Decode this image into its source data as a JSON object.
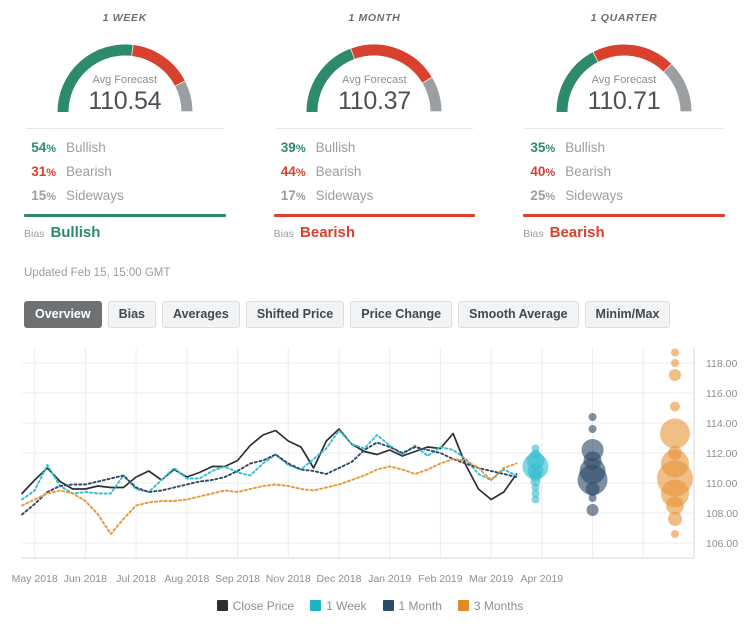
{
  "panels": [
    {
      "title": "1 WEEK",
      "gauge_label": "Avg Forecast",
      "value": "110.54",
      "bullish_pct": "54",
      "bearish_pct": "31",
      "sideways_pct": "15",
      "bullish_label": "Bullish",
      "bearish_label": "Bearish",
      "sideways_label": "Sideways",
      "bias_word": "Bias",
      "bias_value": "Bullish",
      "bias_color": "#2d8a6a"
    },
    {
      "title": "1 MONTH",
      "gauge_label": "Avg Forecast",
      "value": "110.37",
      "bullish_pct": "39",
      "bearish_pct": "44",
      "sideways_pct": "17",
      "bullish_label": "Bullish",
      "bearish_label": "Bearish",
      "sideways_label": "Sideways",
      "bias_word": "Bias",
      "bias_value": "Bearish",
      "bias_color": "#d7412e"
    },
    {
      "title": "1 QUARTER",
      "gauge_label": "Avg Forecast",
      "value": "110.71",
      "bullish_pct": "35",
      "bearish_pct": "40",
      "sideways_pct": "25",
      "bullish_label": "Bullish",
      "bearish_label": "Bearish",
      "sideways_label": "Sideways",
      "bias_word": "Bias",
      "bias_value": "Bearish",
      "bias_color": "#d7412e"
    }
  ],
  "colors": {
    "bullish": "#2d8a6a",
    "bearish": "#d7412e",
    "sideways": "#9b9fa2",
    "close_price": "#2b2f33",
    "one_week": "#35bfd0",
    "one_month": "#2d4b68",
    "three_months": "#e8963a"
  },
  "updated": "Updated Feb 15, 15:00 GMT",
  "tabs": [
    {
      "label": "Overview",
      "active": true
    },
    {
      "label": "Bias",
      "active": false
    },
    {
      "label": "Averages",
      "active": false
    },
    {
      "label": "Shifted Price",
      "active": false
    },
    {
      "label": "Price Change",
      "active": false
    },
    {
      "label": "Smooth Average",
      "active": false
    },
    {
      "label": "Minim/Max",
      "active": false
    }
  ],
  "legend": [
    {
      "label": "Close Price",
      "color": "#2b2f33"
    },
    {
      "label": "1 Week",
      "color": "#19b5c4"
    },
    {
      "label": "1 Month",
      "color": "#2d4b68"
    },
    {
      "label": "3 Months",
      "color": "#e08a28"
    }
  ],
  "chart_data": {
    "type": "line",
    "title": "",
    "xlabel": "",
    "ylabel": "",
    "ylim": [
      105.0,
      119.0
    ],
    "yticks": [
      "106.00",
      "108.00",
      "110.00",
      "112.00",
      "114.00",
      "116.00",
      "118.00"
    ],
    "ytick_values": [
      106,
      108,
      110,
      112,
      114,
      116,
      118
    ],
    "grid": true,
    "legend_position": "bottom",
    "xticks": [
      "May 2018",
      "Jun 2018",
      "Jul 2018",
      "Aug 2018",
      "Sep 2018",
      "Nov 2018",
      "Dec 2018",
      "Jan 2019",
      "Feb 2019",
      "Mar 2019",
      "Apr 2019"
    ],
    "x": [
      0,
      1,
      2,
      3,
      4,
      5,
      6,
      7,
      8,
      9,
      10,
      11,
      12,
      13,
      14,
      15,
      16,
      17,
      18,
      19,
      20,
      21,
      22,
      23,
      24,
      25,
      26,
      27,
      28,
      29,
      30,
      31,
      32,
      33,
      34,
      35,
      36,
      37,
      38,
      39
    ],
    "series": [
      {
        "name": "Close Price",
        "color": "#2b2f33",
        "style": "solid",
        "values": [
          109.3,
          110.2,
          111.0,
          110.1,
          109.6,
          109.6,
          109.8,
          109.7,
          109.7,
          110.4,
          110.8,
          110.2,
          110.9,
          110.4,
          110.7,
          111.1,
          111.1,
          111.5,
          112.5,
          113.2,
          113.5,
          112.8,
          112.4,
          111.0,
          112.8,
          113.6,
          112.6,
          112.1,
          111.9,
          112.2,
          111.8,
          112.1,
          112.4,
          112.3,
          113.3,
          111.2,
          109.6,
          108.9,
          109.4,
          110.6
        ]
      },
      {
        "name": "1 Week",
        "color": "#35bfd0",
        "style": "dotted",
        "values": [
          108.9,
          109.5,
          111.2,
          109.8,
          109.3,
          109.4,
          109.3,
          109.3,
          110.5,
          109.6,
          109.4,
          110.2,
          111.0,
          110.3,
          110.3,
          110.8,
          111.1,
          110.7,
          110.5,
          111.3,
          111.9,
          111.2,
          110.9,
          111.6,
          112.3,
          113.5,
          112.6,
          112.3,
          113.2,
          112.5,
          111.9,
          112.5,
          111.8,
          112.4,
          112.2,
          111.6,
          110.6,
          110.2,
          110.9,
          110.5
        ]
      },
      {
        "name": "1 Month",
        "color": "#2d4b68",
        "style": "dotted",
        "values": [
          107.9,
          108.6,
          109.4,
          109.8,
          109.9,
          109.9,
          110.1,
          110.3,
          110.5,
          109.7,
          109.4,
          109.5,
          109.7,
          109.9,
          110.1,
          110.2,
          110.4,
          110.8,
          111.3,
          111.5,
          111.9,
          111.3,
          110.9,
          110.8,
          110.6,
          111.0,
          111.4,
          112.2,
          112.7,
          112.4,
          112.0,
          112.4,
          112.2,
          112.0,
          111.6,
          111.3,
          111.0,
          110.8,
          110.6,
          110.4
        ]
      },
      {
        "name": "3 Months",
        "color": "#e8963a",
        "style": "dotted",
        "values": [
          108.5,
          108.9,
          109.3,
          109.5,
          109.3,
          108.8,
          107.9,
          106.6,
          107.6,
          108.5,
          108.7,
          108.8,
          108.8,
          108.9,
          109.1,
          109.3,
          109.5,
          109.4,
          109.6,
          109.8,
          109.9,
          109.8,
          109.6,
          109.5,
          109.7,
          109.9,
          110.2,
          110.5,
          110.9,
          111.1,
          110.9,
          110.6,
          110.9,
          111.3,
          111.6,
          111.5,
          111.0,
          110.2,
          111.0,
          111.3
        ]
      }
    ],
    "bubble_clusters": [
      {
        "name": "1 Week",
        "color": "#35bfd0",
        "x_label": "Feb 2019",
        "points": [
          {
            "value": 112.3,
            "size": 4
          },
          {
            "value": 111.9,
            "size": 5
          },
          {
            "value": 111.5,
            "size": 9
          },
          {
            "value": 111.1,
            "size": 13
          },
          {
            "value": 110.8,
            "size": 8
          },
          {
            "value": 110.5,
            "size": 6
          },
          {
            "value": 110.1,
            "size": 5
          },
          {
            "value": 109.7,
            "size": 4
          },
          {
            "value": 109.3,
            "size": 4
          },
          {
            "value": 108.9,
            "size": 4
          }
        ]
      },
      {
        "name": "1 Month",
        "color": "#2d4b68",
        "x_label": "Mar 2019",
        "points": [
          {
            "value": 114.4,
            "size": 4
          },
          {
            "value": 113.6,
            "size": 4
          },
          {
            "value": 112.2,
            "size": 11
          },
          {
            "value": 111.5,
            "size": 9
          },
          {
            "value": 110.8,
            "size": 13
          },
          {
            "value": 110.2,
            "size": 15
          },
          {
            "value": 109.6,
            "size": 7
          },
          {
            "value": 109.0,
            "size": 4
          },
          {
            "value": 108.2,
            "size": 6
          }
        ]
      },
      {
        "name": "3 Months",
        "color": "#e8963a",
        "x_label": "Apr 2019",
        "points": [
          {
            "value": 118.7,
            "size": 4
          },
          {
            "value": 118.0,
            "size": 4
          },
          {
            "value": 117.2,
            "size": 6
          },
          {
            "value": 115.1,
            "size": 5
          },
          {
            "value": 113.3,
            "size": 15
          },
          {
            "value": 112.0,
            "size": 7
          },
          {
            "value": 111.3,
            "size": 14
          },
          {
            "value": 110.3,
            "size": 18
          },
          {
            "value": 109.3,
            "size": 14
          },
          {
            "value": 108.5,
            "size": 9
          },
          {
            "value": 107.6,
            "size": 7
          },
          {
            "value": 106.6,
            "size": 4
          }
        ]
      }
    ]
  }
}
